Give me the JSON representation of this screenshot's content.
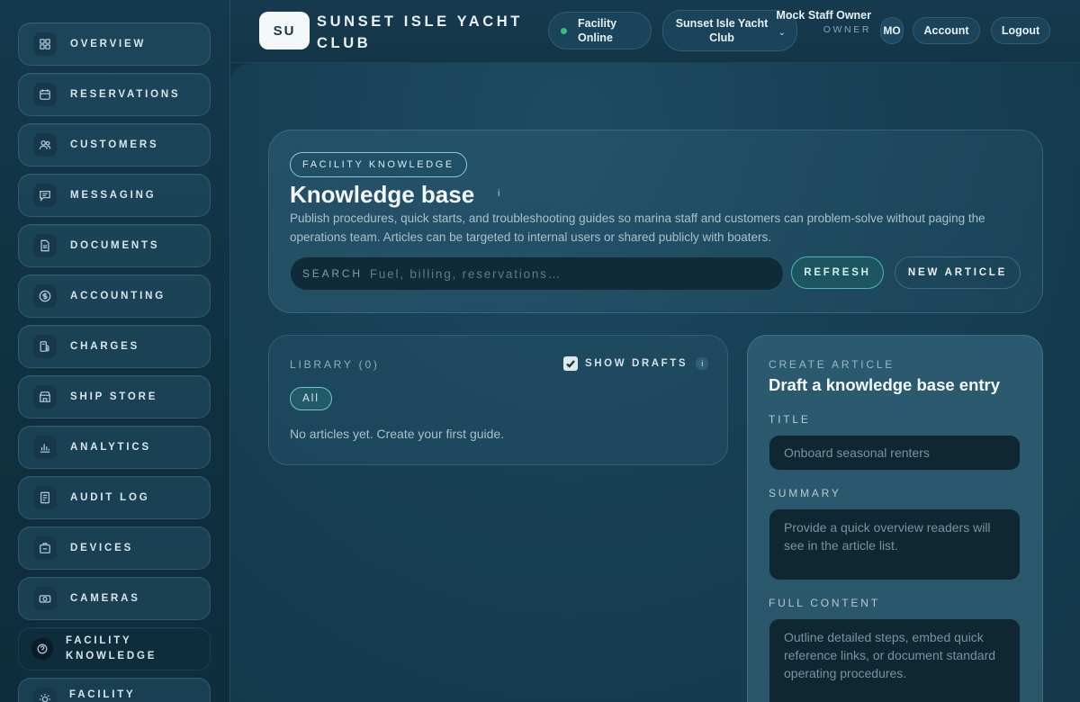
{
  "sidebar": {
    "items": [
      {
        "label": "OVERVIEW",
        "icon": "grid-icon"
      },
      {
        "label": "RESERVATIONS",
        "icon": "calendar-icon"
      },
      {
        "label": "CUSTOMERS",
        "icon": "users-icon"
      },
      {
        "label": "MESSAGING",
        "icon": "message-icon"
      },
      {
        "label": "DOCUMENTS",
        "icon": "document-icon"
      },
      {
        "label": "ACCOUNTING",
        "icon": "dollar-icon"
      },
      {
        "label": "CHARGES",
        "icon": "fuel-icon"
      },
      {
        "label": "SHIP STORE",
        "icon": "store-icon"
      },
      {
        "label": "ANALYTICS",
        "icon": "chart-icon"
      },
      {
        "label": "AUDIT LOG",
        "icon": "log-icon"
      },
      {
        "label": "DEVICES",
        "icon": "device-icon"
      },
      {
        "label": "CAMERAS",
        "icon": "camera-icon"
      },
      {
        "label": "FACILITY KNOWLEDGE",
        "icon": "help-icon",
        "active": true
      },
      {
        "label": "FACILITY",
        "icon": "sun-icon"
      }
    ]
  },
  "header": {
    "logo_initials": "SU",
    "club_name": "SUNSET ISLE YACHT CLUB",
    "status": "Facility Online",
    "status_color": "#2ec27e",
    "facility_select": "Sunset Isle Yacht Club",
    "staff_name": "Mock Staff Owner",
    "staff_role": "OWNER",
    "avatar_initials": "MO",
    "account_label": "Account",
    "logout_label": "Logout"
  },
  "hero": {
    "tag": "FACILITY KNOWLEDGE",
    "title": "Knowledge base",
    "info_glyph": "i",
    "description": "Publish procedures, quick starts, and troubleshooting guides so marina staff and customers can problem-solve without paging the operations team. Articles can be targeted to internal users or shared publicly with boaters.",
    "search_label": "SEARCH",
    "search_placeholder": "Fuel, billing, reservations…",
    "search_value": "",
    "refresh_label": "REFRESH",
    "new_article_label": "NEW ARTICLE"
  },
  "library": {
    "heading": "LIBRARY (0)",
    "show_drafts_label": "SHOW DRAFTS",
    "show_drafts_checked": true,
    "info_glyph": "i",
    "filter_all": "All",
    "empty_message": "No articles yet. Create your first guide."
  },
  "create": {
    "eyebrow": "CREATE ARTICLE",
    "title": "Draft a knowledge base entry",
    "title_label": "TITLE",
    "title_placeholder": "Onboard seasonal renters",
    "summary_label": "SUMMARY",
    "summary_placeholder": "Provide a quick overview readers will see in the article list.",
    "content_label": "FULL CONTENT",
    "content_placeholder": "Outline detailed steps, embed quick reference links, or document standard operating procedures."
  }
}
